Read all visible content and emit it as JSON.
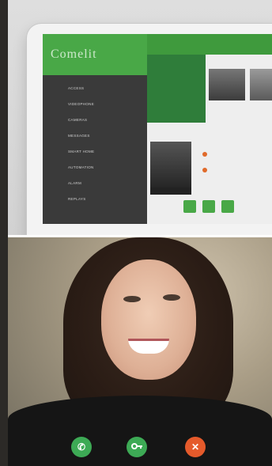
{
  "tablet": {
    "brand": "Comelit",
    "menu": [
      "ACCESS",
      "VIDEOPHONE",
      "CAMERAS",
      "MESSAGES",
      "SMART HOME",
      "AUTOMATION",
      "ALARM",
      "REPLAYS"
    ]
  },
  "call": {
    "accept_icon": "phone-icon",
    "door_icon": "key-icon",
    "reject_icon": "close-icon",
    "colors": {
      "accept": "#3daa55",
      "door": "#3daa55",
      "reject": "#e55a2b"
    }
  }
}
